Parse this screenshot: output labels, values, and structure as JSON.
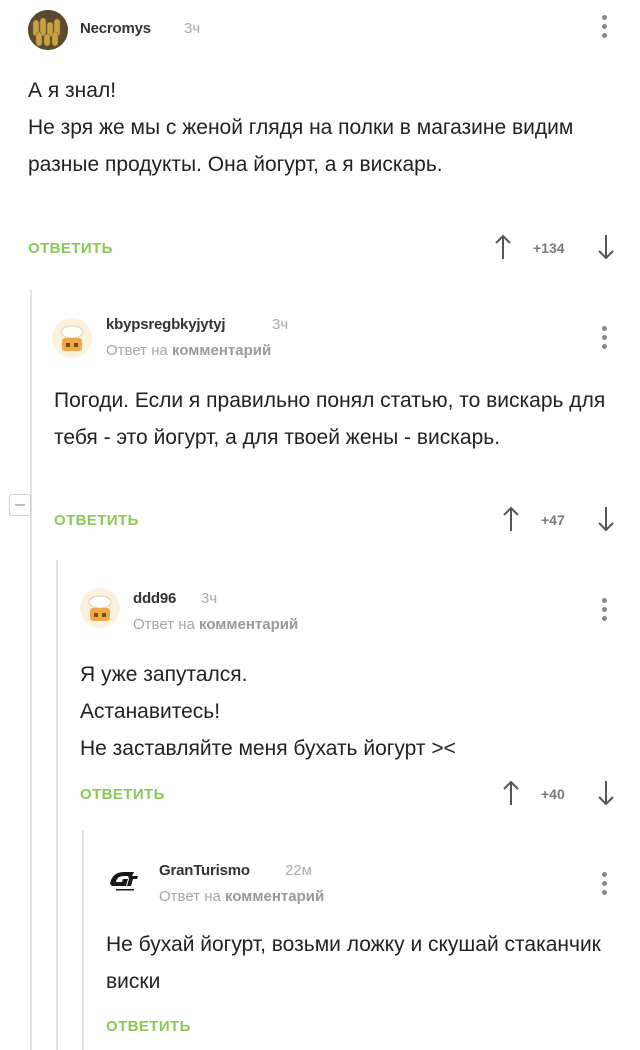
{
  "comments": [
    {
      "author": "Necromys",
      "time": "3ч",
      "reply_to_label": "",
      "reply_to_target": "",
      "text": "А я знал!\nНе зря же мы с женой глядя на полки в магазине видим разные продукты. Она йогурт, а я вискарь.",
      "reply_label": "ОТВЕТИТЬ",
      "rating": "+134"
    },
    {
      "author": "kbypsregbkyjytyj",
      "time": "3ч",
      "reply_to_label": "Ответ на",
      "reply_to_target": "комментарий",
      "text": "Погоди. Если я правильно понял статью, то вискарь для тебя - это йогурт, а для твоей жены - вискарь.",
      "reply_label": "ОТВЕТИТЬ",
      "rating": "+47"
    },
    {
      "author": "ddd96",
      "time": "3ч",
      "reply_to_label": "Ответ на",
      "reply_to_target": "комментарий",
      "text": "Я уже запутался.\nАстанавитесь!\nНе заставляйте меня бухать йогурт ><",
      "reply_label": "ОТВЕТИТЬ",
      "rating": "+40"
    },
    {
      "author": "GranTurismo",
      "time": "22м",
      "reply_to_label": "Ответ на",
      "reply_to_target": "комментарий",
      "text": "Не бухай йогурт, возьми ложку и скушай стаканчик виски",
      "reply_label": "ОТВЕТИТЬ",
      "rating": ""
    }
  ],
  "colors": {
    "reply_green": "#8ac858",
    "meta_gray": "#a6a6a6",
    "thread_line": "#e2e2e2"
  },
  "icons": [
    "menu-dots-icon",
    "arrow-up-icon",
    "arrow-down-icon",
    "collapse-icon"
  ]
}
